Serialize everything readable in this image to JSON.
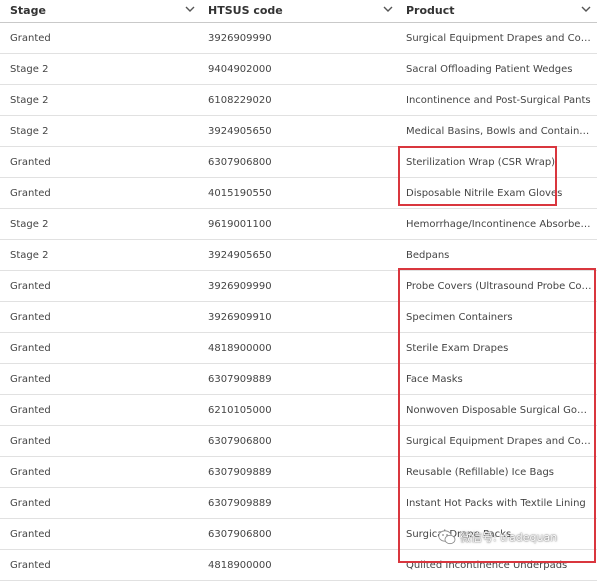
{
  "columns": [
    {
      "label": "Stage"
    },
    {
      "label": "HTSUS code"
    },
    {
      "label": "Product"
    }
  ],
  "rows": [
    {
      "stage": "Granted",
      "code": "3926909990",
      "product": "Surgical Equipment Drapes and Covers"
    },
    {
      "stage": "Stage 2",
      "code": "9404902000",
      "product": "Sacral Offloading Patient Wedges"
    },
    {
      "stage": "Stage 2",
      "code": "6108229020",
      "product": "Incontinence and Post-Surgical Pants"
    },
    {
      "stage": "Stage 2",
      "code": "3924905650",
      "product": "Medical Basins, Bowls and Containers"
    },
    {
      "stage": "Granted",
      "code": "6307906800",
      "product": "Sterilization Wrap (CSR Wrap)"
    },
    {
      "stage": "Granted",
      "code": "4015190550",
      "product": "Disposable Nitrile Exam Gloves"
    },
    {
      "stage": "Stage 2",
      "code": "9619001100",
      "product": "Hemorrhage/Incontinence Absorbent Pads"
    },
    {
      "stage": "Stage 2",
      "code": "3924905650",
      "product": "Bedpans"
    },
    {
      "stage": "Granted",
      "code": "3926909990",
      "product": "Probe Covers (Ultrasound Probe Covers)"
    },
    {
      "stage": "Granted",
      "code": "3926909910",
      "product": "Specimen Containers"
    },
    {
      "stage": "Granted",
      "code": "4818900000",
      "product": "Sterile Exam Drapes"
    },
    {
      "stage": "Granted",
      "code": "6307909889",
      "product": "Face Masks"
    },
    {
      "stage": "Granted",
      "code": "6210105000",
      "product": "Nonwoven Disposable Surgical Gowns"
    },
    {
      "stage": "Granted",
      "code": "6307906800",
      "product": "Surgical Equipment Drapes and Covers"
    },
    {
      "stage": "Granted",
      "code": "6307909889",
      "product": "Reusable (Refillable) Ice Bags"
    },
    {
      "stage": "Granted",
      "code": "6307909889",
      "product": "Instant Hot Packs with Textile Lining"
    },
    {
      "stage": "Granted",
      "code": "6307906800",
      "product": "Surgical Drape Packs"
    },
    {
      "stage": "Granted",
      "code": "4818900000",
      "product": "Quilted Incontinence Underpads"
    }
  ],
  "watermark": {
    "text": "微信号: tradequan",
    "icon": "wechat-icon"
  },
  "colors": {
    "highlight": "#d9363e",
    "header_border": "#c9c9c9",
    "row_border": "#e1e1e1"
  }
}
